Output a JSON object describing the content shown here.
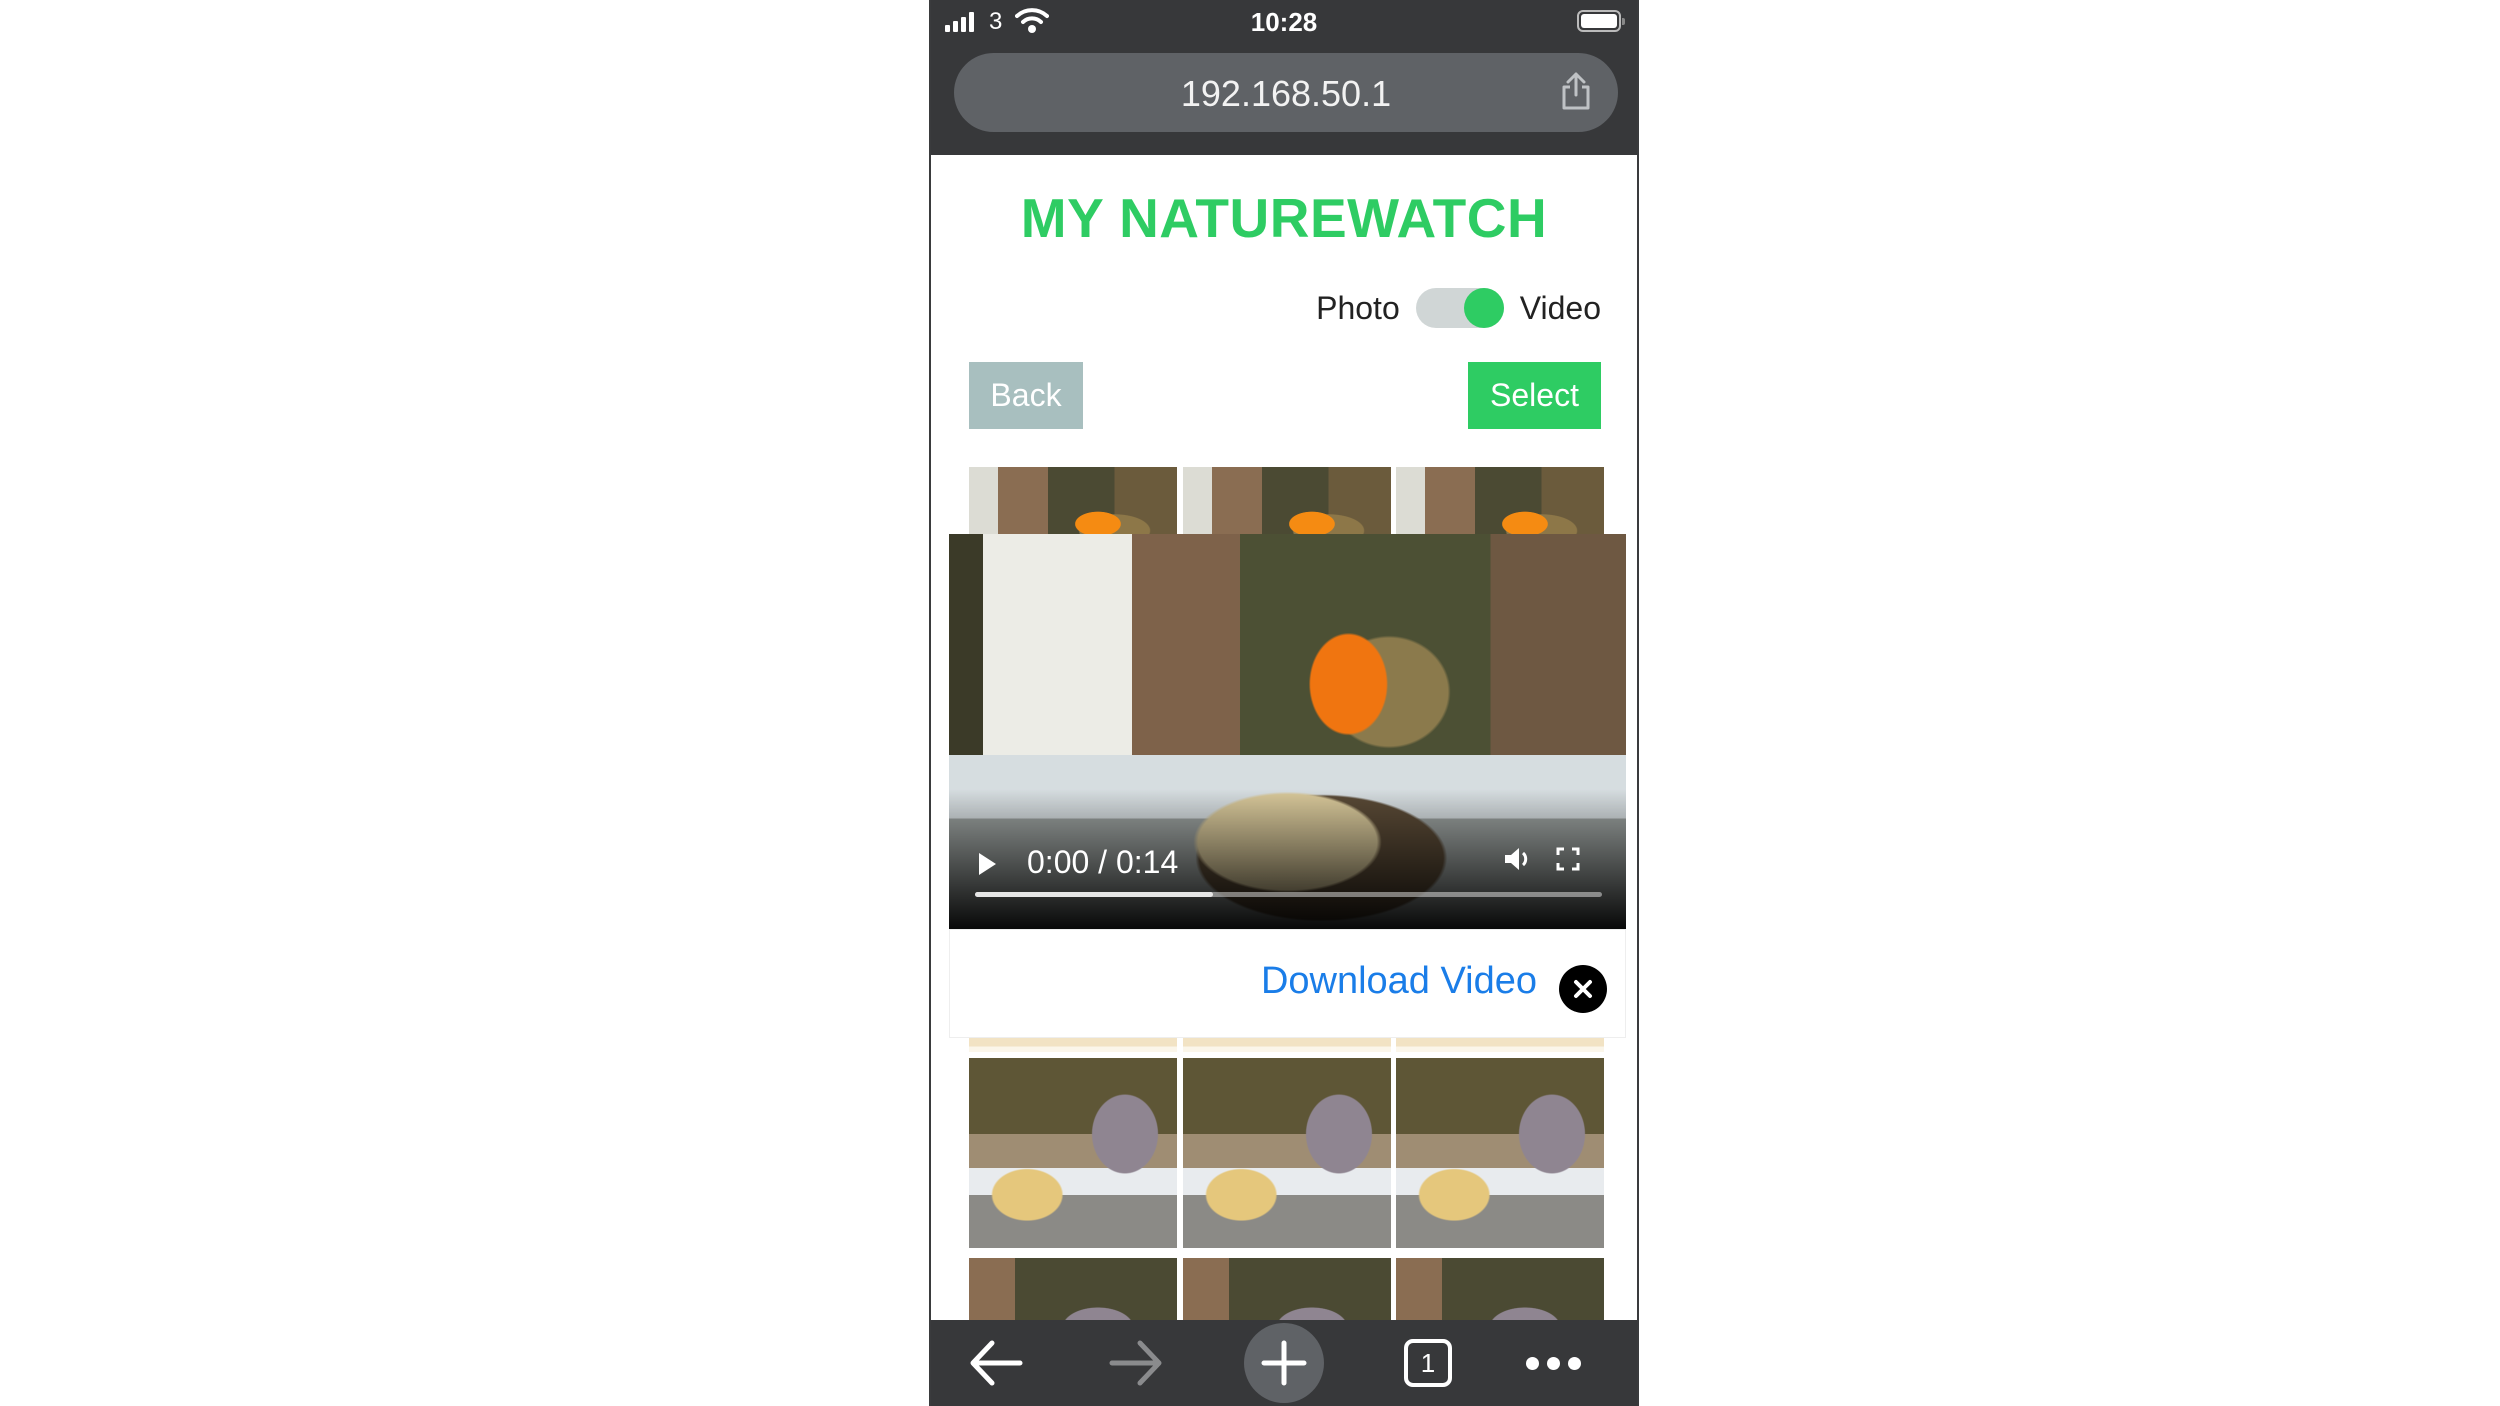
{
  "status_bar": {
    "carrier": "3",
    "time": "10:28",
    "icons": [
      "signal-icon",
      "wifi-icon",
      "battery-icon"
    ]
  },
  "browser": {
    "url": "192.168.50.1",
    "share_icon": "share-icon",
    "toolbar": {
      "back_icon": "arrow-left-icon",
      "forward_icon": "arrow-right-icon",
      "new_tab_icon": "plus-icon",
      "tab_count": "1",
      "more_icon": "more-dots-icon"
    }
  },
  "page": {
    "title": "MY NATUREWATCH",
    "mode_toggle": {
      "left_label": "Photo",
      "right_label": "Video",
      "selected": "Video"
    },
    "back_label": "Back",
    "select_label": "Select",
    "colors": {
      "accent": "#2ecc63",
      "back_button": "#a8bfbf",
      "link": "#1a7de8",
      "browser_chrome": "#37383a"
    }
  },
  "video_modal": {
    "time_display": "0:00 / 0:14",
    "current_time": "0:00",
    "duration": "0:14",
    "buffered_fraction": 0.38,
    "icons": [
      "play-icon",
      "volume-icon",
      "fullscreen-icon"
    ],
    "download_label": "Download Video",
    "close_icon": "close-icon"
  },
  "gallery": {
    "rows": [
      {
        "subject": "robin",
        "count": 3
      },
      {
        "subject": "feeder",
        "count": 3
      },
      {
        "subject": "wood-pigeon",
        "count": 3
      },
      {
        "subject": "wood-pigeon",
        "count": 3
      }
    ]
  }
}
